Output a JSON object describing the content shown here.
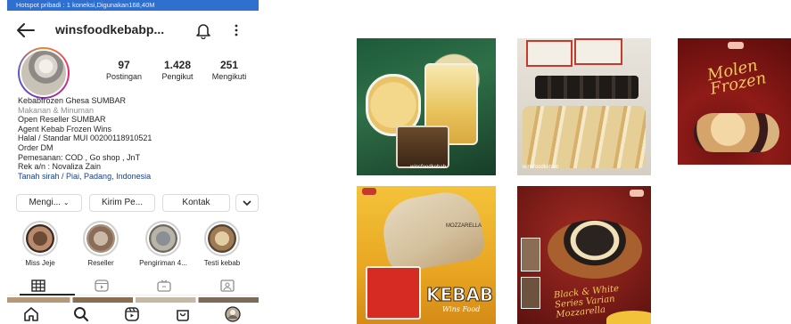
{
  "status_bar": {
    "text": "Hotspot pribadi : 1 koneksi,Digunakan168,40M"
  },
  "header": {
    "username": "winsfoodkebabp..."
  },
  "stats": [
    {
      "value": "97",
      "label": "Postingan"
    },
    {
      "value": "1.428",
      "label": "Pengikut"
    },
    {
      "value": "251",
      "label": "Mengikuti"
    }
  ],
  "bio": {
    "name": "Kebabfrozen Ghesa SUMBAR",
    "category": "Makanan & Minuman",
    "lines": [
      "Open Reseller SUMBAR",
      "Agent Kebab Frozen Wins",
      "Halal / Standar MUI 00200118910521",
      "Order DM",
      "Pemesanan:  COD , Go shop , JnT",
      "Rek a/n : Novaliza Zain"
    ],
    "location": "Tanah sirah / Piai, Padang, Indonesia"
  },
  "actions": {
    "following": "Mengi...",
    "message": "Kirim Pe...",
    "contact": "Kontak"
  },
  "highlights": [
    {
      "label": "Miss Jeje"
    },
    {
      "label": "Reseller"
    },
    {
      "label": "Pengiriman 4..."
    },
    {
      "label": "Testi kebab"
    }
  ],
  "posts": {
    "p1": {
      "watermark": "winsfoodkebab"
    },
    "p2": {
      "watermark": "winsfoodkebab"
    },
    "p3": {
      "title": "Molen Frozen"
    },
    "p4": {
      "tag": "MOZZARELLA",
      "title": "KEBAB",
      "subtitle": "Wins Food"
    },
    "p5": {
      "title": "Black & White Series Varian Mozzarella"
    }
  },
  "colors": {
    "status_bar": "#2f6fd0",
    "link": "#1a3d8f",
    "post_red": "#8f1b17",
    "post_yellow": "#f3c33a"
  }
}
